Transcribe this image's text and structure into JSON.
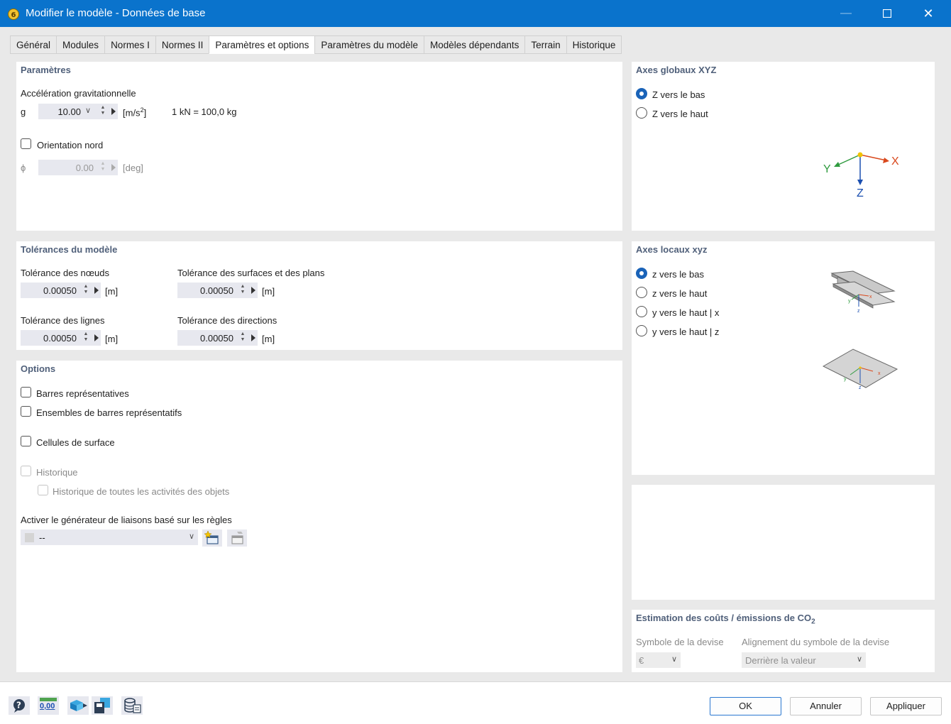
{
  "window": {
    "title": "Modifier le modèle - Données de base",
    "minimize_icon": "minimize-icon",
    "maximize_icon": "maximize-icon",
    "close_icon": "close-icon"
  },
  "tabs": [
    {
      "label": "Général"
    },
    {
      "label": "Modules"
    },
    {
      "label": "Normes I"
    },
    {
      "label": "Normes II"
    },
    {
      "label": "Paramètres et options",
      "active": true
    },
    {
      "label": "Paramètres du modèle"
    },
    {
      "label": "Modèles dépendants"
    },
    {
      "label": "Terrain"
    },
    {
      "label": "Historique"
    }
  ],
  "parameters": {
    "title": "Paramètres",
    "gravity_label": "Accélération gravitationnelle",
    "g_symbol": "g",
    "g_value": "10.00",
    "g_unit_base": "[m/s",
    "g_unit_exp": "2",
    "g_unit_close": "]",
    "g_conversion": "1 kN = 100,0 kg",
    "north_label": "Orientation nord",
    "north_checked": false,
    "phi_symbol": "ϕ",
    "phi_value": "0.00",
    "phi_unit": "[deg]"
  },
  "tolerances": {
    "title": "Tolérances du modèle",
    "nodes_label": "Tolérance des nœuds",
    "nodes_value": "0.00050",
    "surfaces_label": "Tolérance des surfaces et des plans",
    "surfaces_value": "0.00050",
    "lines_label": "Tolérance des lignes",
    "lines_value": "0.00050",
    "directions_label": "Tolérance des directions",
    "directions_value": "0.00050",
    "unit": "[m]"
  },
  "options": {
    "title": "Options",
    "rep_bars": "Barres représentatives",
    "rep_sets": "Ensembles de barres représentatifs",
    "surface_cells": "Cellules de surface",
    "history": "Historique",
    "history_all": "Historique de toutes les activités des objets",
    "generator_label": "Activer le générateur de liaisons basé sur les règles",
    "generator_value": "--"
  },
  "global_axes": {
    "title": "Axes globaux XYZ",
    "options": [
      "Z vers le bas",
      "Z vers le haut"
    ],
    "selected": 0,
    "axis_x": "X",
    "axis_y": "Y",
    "axis_z": "Z"
  },
  "local_axes": {
    "title": "Axes locaux xyz",
    "options": [
      "z vers le bas",
      "z vers le haut",
      "y vers le haut | x",
      "y vers le haut | z"
    ],
    "selected": 0
  },
  "cost": {
    "title": "Estimation des coûts / émissions de CO",
    "title_sub": "2",
    "currency_label": "Symbole de la devise",
    "currency_value": "€",
    "alignment_label": "Alignement du symbole de la devise",
    "alignment_value": "Derrière la valeur"
  },
  "footer": {
    "icons": [
      "help-icon",
      "units-icon",
      "model-view-icon",
      "save-template-icon",
      "database-icon"
    ],
    "units_text": "0,00",
    "ok": "OK",
    "cancel": "Annuler",
    "apply": "Appliquer"
  }
}
